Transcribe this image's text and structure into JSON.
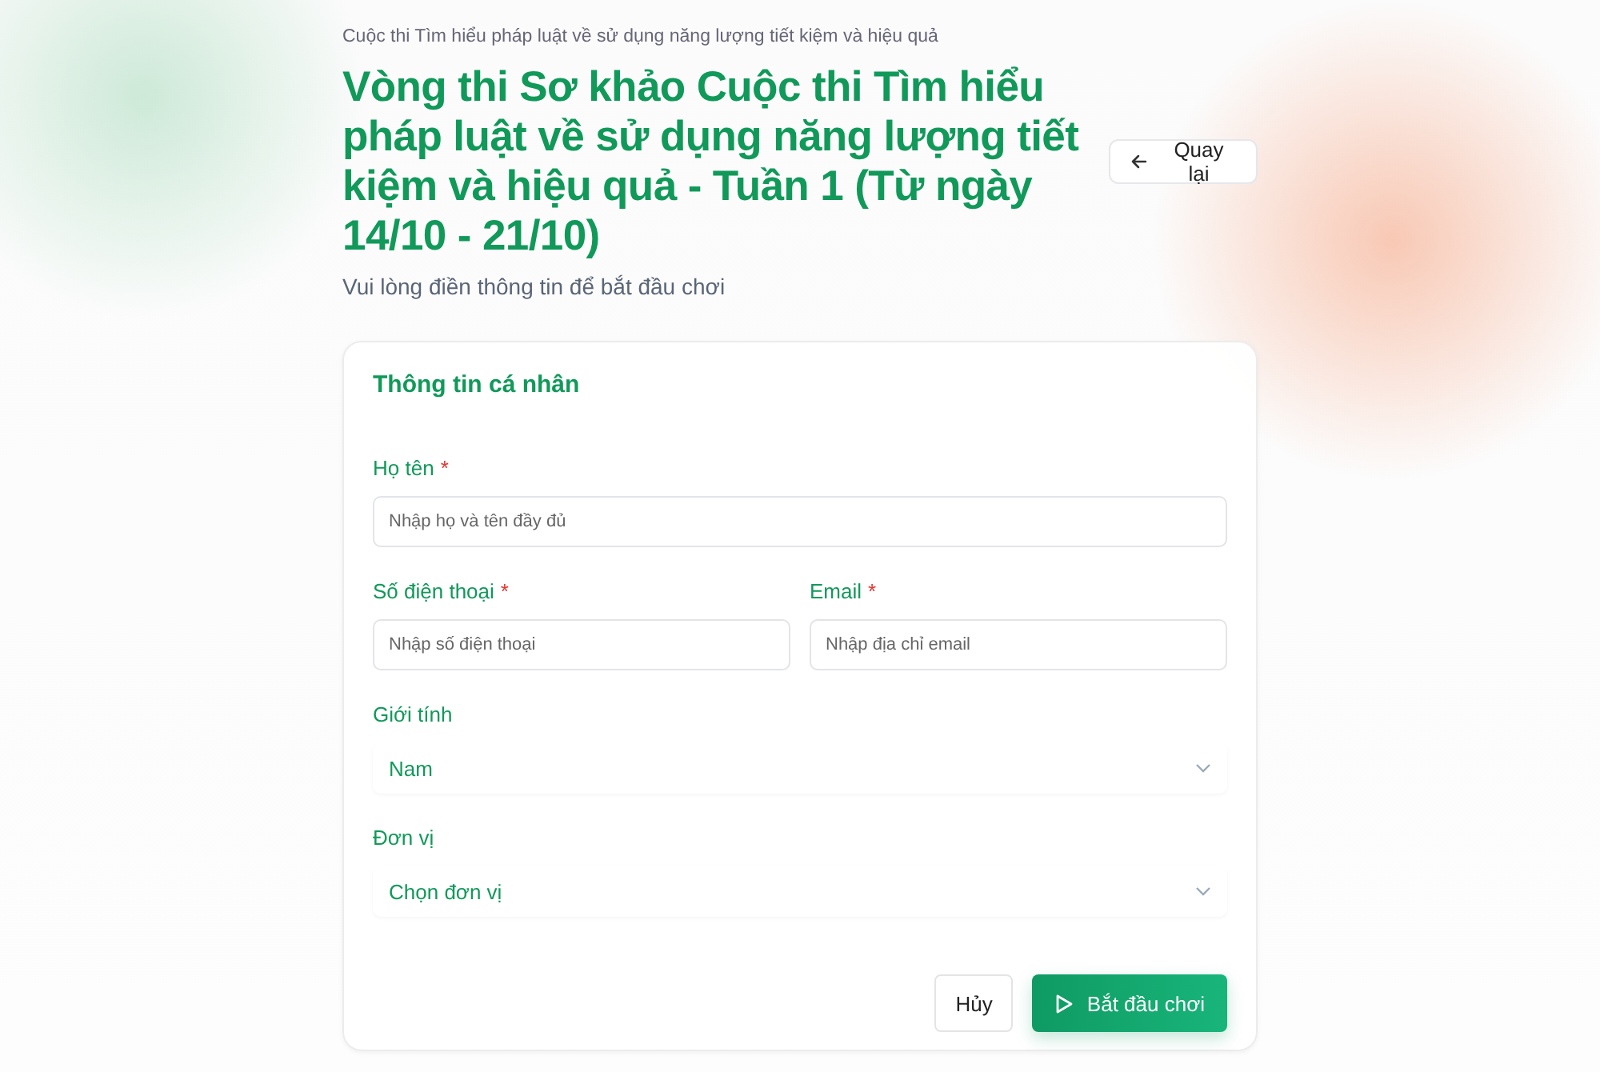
{
  "header": {
    "breadcrumb": "Cuộc thi Tìm hiểu pháp luật về sử dụng năng lượng tiết kiệm và hiệu quả",
    "title": "Vòng thi Sơ khảo Cuộc thi Tìm hiểu pháp luật về sử dụng năng lượng tiết kiệm và hiệu quả - Tuần 1 (Từ ngày 14/10 - 21/10)",
    "subtitle": "Vui lòng điền thông tin để bắt đầu chơi",
    "back_button": "Quay lại"
  },
  "form": {
    "title": "Thông tin cá nhân",
    "rows": [
      [
        {
          "kind": "input",
          "label": "Họ tên",
          "required_mark": "*",
          "placeholder": "Nhập họ và tên đầy đủ"
        }
      ],
      [
        {
          "kind": "input",
          "label": "Số điện thoại",
          "required_mark": "*",
          "placeholder": "Nhập số điện thoại"
        },
        {
          "kind": "input",
          "label": "Email",
          "required_mark": "*",
          "placeholder": "Nhập địa chỉ email"
        }
      ],
      [
        {
          "kind": "select",
          "label": "Giới tính",
          "value": "Nam"
        }
      ],
      [
        {
          "kind": "select",
          "label": "Đơn vị",
          "value": "Chọn đơn vị"
        }
      ]
    ],
    "cancel_button": "Hủy",
    "start_button": "Bắt đầu chơi"
  }
}
